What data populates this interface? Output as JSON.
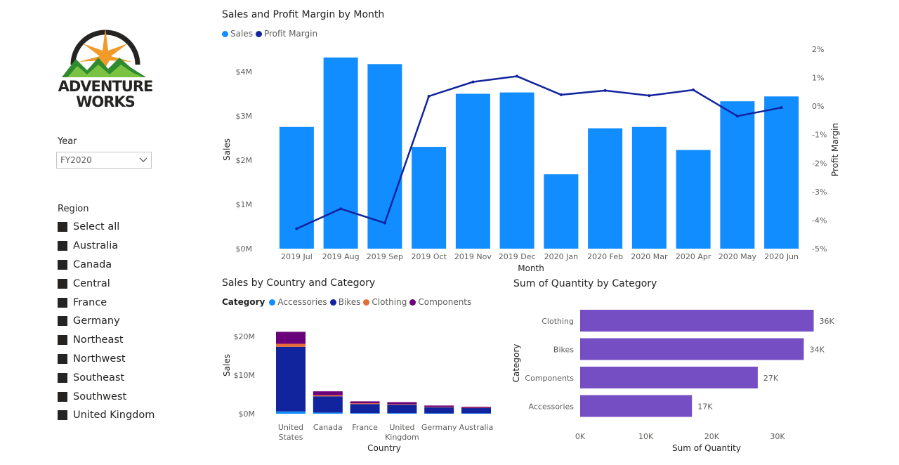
{
  "logo": {
    "line1": "Adventure",
    "line2": "Works"
  },
  "year_slicer": {
    "title": "Year",
    "selected": "FY2020"
  },
  "region_slicer": {
    "title": "Region",
    "items": [
      {
        "label": "Select all"
      },
      {
        "label": "Australia"
      },
      {
        "label": "Canada"
      },
      {
        "label": "Central"
      },
      {
        "label": "France"
      },
      {
        "label": "Germany"
      },
      {
        "label": "Northeast"
      },
      {
        "label": "Northwest"
      },
      {
        "label": "Southeast"
      },
      {
        "label": "Southwest"
      },
      {
        "label": "United Kingdom"
      }
    ]
  },
  "colors": {
    "sales": "#118DFF",
    "margin": "#12239E",
    "accessories": "#118DFF",
    "bikes": "#12239E",
    "clothing": "#E66C37",
    "components": "#6B007B",
    "quantity": "#744EC2"
  },
  "chart_data": [
    {
      "type": "bar",
      "title": "Sales and Profit Margin by Month",
      "xlabel": "Month",
      "ylabel": "Sales",
      "y2label": "Profit Margin",
      "categories": [
        "2019 Jul",
        "2019 Aug",
        "2019 Sep",
        "2019 Oct",
        "2019 Nov",
        "2019 Dec",
        "2020 Jan",
        "2020 Feb",
        "2020 Mar",
        "2020 Apr",
        "2020 May",
        "2020 Jun"
      ],
      "series": [
        {
          "name": "Sales",
          "type": "bar",
          "values": [
            2.75,
            4.32,
            4.17,
            2.3,
            3.5,
            3.53,
            1.68,
            2.72,
            2.75,
            2.23,
            3.33,
            3.44
          ],
          "unit": "$M"
        },
        {
          "name": "Profit Margin",
          "type": "line",
          "values": [
            -4.3,
            -3.6,
            -4.1,
            0.35,
            0.85,
            1.05,
            0.4,
            0.55,
            0.37,
            0.57,
            -0.35,
            -0.05
          ],
          "unit": "%"
        }
      ],
      "ylim": [
        0,
        4.5
      ],
      "y2lim": [
        -5,
        2
      ],
      "yticks": [
        "$0M",
        "$1M",
        "$2M",
        "$3M",
        "$4M"
      ],
      "y2ticks": [
        "-5%",
        "-4%",
        "-3%",
        "-2%",
        "-1%",
        "0%",
        "1%",
        "2%"
      ],
      "legend": "top-left",
      "grid": false
    },
    {
      "type": "bar",
      "stacked": true,
      "title": "Sales by Country and Category",
      "legend_title": "Category",
      "xlabel": "Country",
      "ylabel": "Sales",
      "categories": [
        "United States",
        "Canada",
        "France",
        "United Kingdom",
        "Germany",
        "Australia"
      ],
      "series": [
        {
          "name": "Accessories",
          "values": [
            0.6,
            0.3,
            0.15,
            0.15,
            0.1,
            0.1
          ]
        },
        {
          "name": "Bikes",
          "values": [
            16.7,
            4.2,
            2.35,
            2.2,
            1.55,
            1.35
          ]
        },
        {
          "name": "Clothing",
          "values": [
            0.8,
            0.3,
            0.2,
            0.15,
            0.12,
            0.1
          ]
        },
        {
          "name": "Components",
          "values": [
            3.1,
            1.0,
            0.5,
            0.5,
            0.35,
            0.25
          ]
        }
      ],
      "ylim": [
        0,
        23
      ],
      "yticks": [
        "$0M",
        "$10M",
        "$20M"
      ],
      "legend": "top-left"
    },
    {
      "type": "bar",
      "orientation": "horizontal",
      "title": "Sum of Quantity by Category",
      "xlabel": "Sum of Quantity",
      "ylabel": "Category",
      "categories": [
        "Clothing",
        "Bikes",
        "Components",
        "Accessories"
      ],
      "values": [
        35.5,
        34,
        27,
        17
      ],
      "data_labels": [
        "36K",
        "34K",
        "27K",
        "17K"
      ],
      "xticks": [
        "0K",
        "10K",
        "20K",
        "30K"
      ],
      "xlim": [
        0,
        35.5
      ]
    }
  ]
}
